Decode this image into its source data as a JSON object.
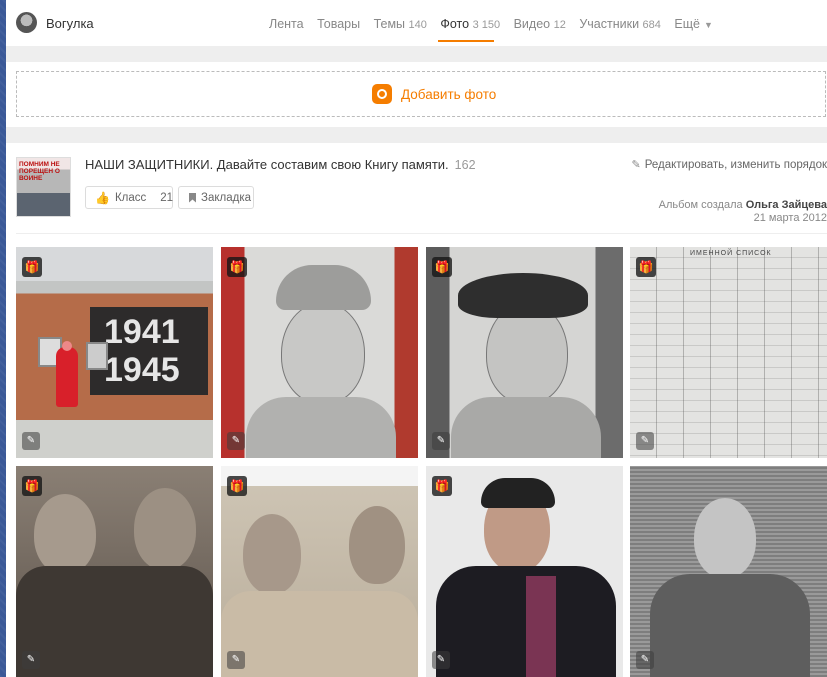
{
  "header": {
    "group_name": "Вогулка",
    "nav": [
      {
        "label": "Лента",
        "count": ""
      },
      {
        "label": "Товары",
        "count": ""
      },
      {
        "label": "Темы",
        "count": "140"
      },
      {
        "label": "Фото",
        "count": "3 150",
        "active": true
      },
      {
        "label": "Видео",
        "count": "12"
      },
      {
        "label": "Участники",
        "count": "684"
      },
      {
        "label": "Ещё",
        "count": ""
      }
    ]
  },
  "add_photo": {
    "label": "Добавить фото"
  },
  "album": {
    "title": "НАШИ ЗАЩИТНИКИ. Давайте составим свою Книгу памяти.",
    "count": "162",
    "edit_link": "Редактировать, изменить порядок",
    "like_label": "Класс",
    "like_count": "21",
    "bookmark_label": "Закладка",
    "created_prefix": "Альбом создала",
    "created_by": "Ольга Зайцева",
    "created_date": "21 марта 2012",
    "thumb_text": "ПОМНИМ НЕ ПОРЕЩЕН О ВОИНЕ"
  },
  "photos": [
    {
      "subject": "memorial-1941-1945",
      "text_top": "1941",
      "text_bottom": "1945"
    },
    {
      "subject": "pencil-portrait-pilotka"
    },
    {
      "subject": "pencil-portrait-cap"
    },
    {
      "subject": "document-list",
      "doc_title": "ИМЕННОЙ СПИСОК"
    },
    {
      "subject": "two-soldiers-dark"
    },
    {
      "subject": "two-soldiers-light"
    },
    {
      "subject": "man-portrait-color"
    },
    {
      "subject": "man-portrait-bw"
    }
  ],
  "icons": {
    "gift": "gift-icon",
    "edit": "pencil-icon",
    "like": "thumbs-up-icon",
    "bookmark": "bookmark-icon",
    "camera": "camera-icon"
  },
  "colors": {
    "accent": "#f57d00",
    "background": "#3b5998"
  }
}
